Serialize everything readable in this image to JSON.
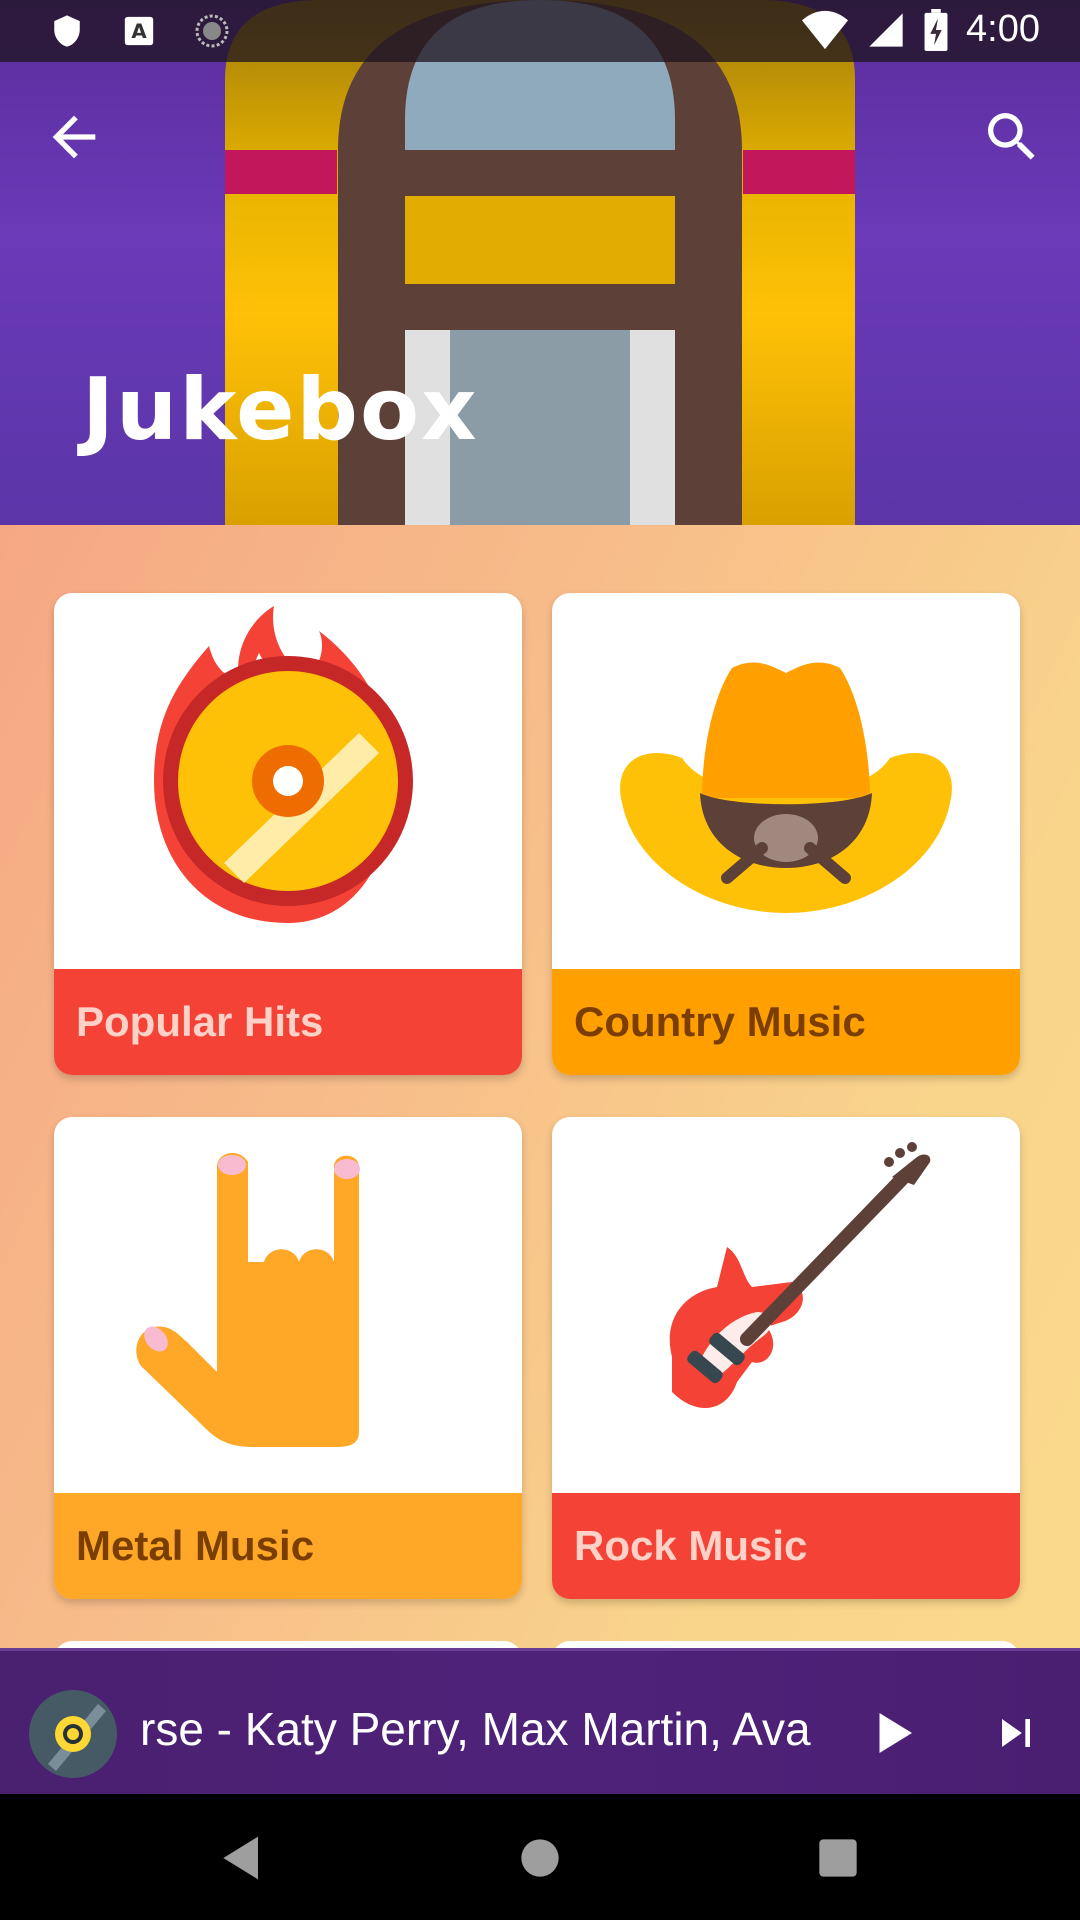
{
  "status_bar": {
    "time": "4:00",
    "left_icons": [
      "shield-icon",
      "accessibility-a-icon",
      "sync-circle-icon"
    ],
    "right_icons": [
      "wifi-icon",
      "signal-icon",
      "battery-charging-icon"
    ]
  },
  "header": {
    "title": "Jukebox",
    "back_icon": "arrow-back-icon",
    "search_icon": "search-icon"
  },
  "categories": [
    {
      "label": "Popular Hits",
      "icon": "fire-disc-icon",
      "bar_color": "#f44336",
      "text_color": "#ffd1c7"
    },
    {
      "label": "Country Music",
      "icon": "cowboy-hat-icon",
      "bar_color": "#ffa000",
      "text_color": "#7a3f00"
    },
    {
      "label": "Metal Music",
      "icon": "rock-hand-icon",
      "bar_color": "#ffa726",
      "text_color": "#7a3f00"
    },
    {
      "label": "Rock Music",
      "icon": "electric-guitar-icon",
      "bar_color": "#f44336",
      "text_color": "#ffd1c7"
    }
  ],
  "player": {
    "track_text": "rse - Katy Perry, Max Martin, Ava",
    "disc_icon": "vinyl-disc-icon",
    "play_icon": "play-icon",
    "next_icon": "skip-next-icon"
  },
  "nav_bar": {
    "icons": [
      "nav-back-icon",
      "nav-home-icon",
      "nav-recents-icon"
    ]
  }
}
